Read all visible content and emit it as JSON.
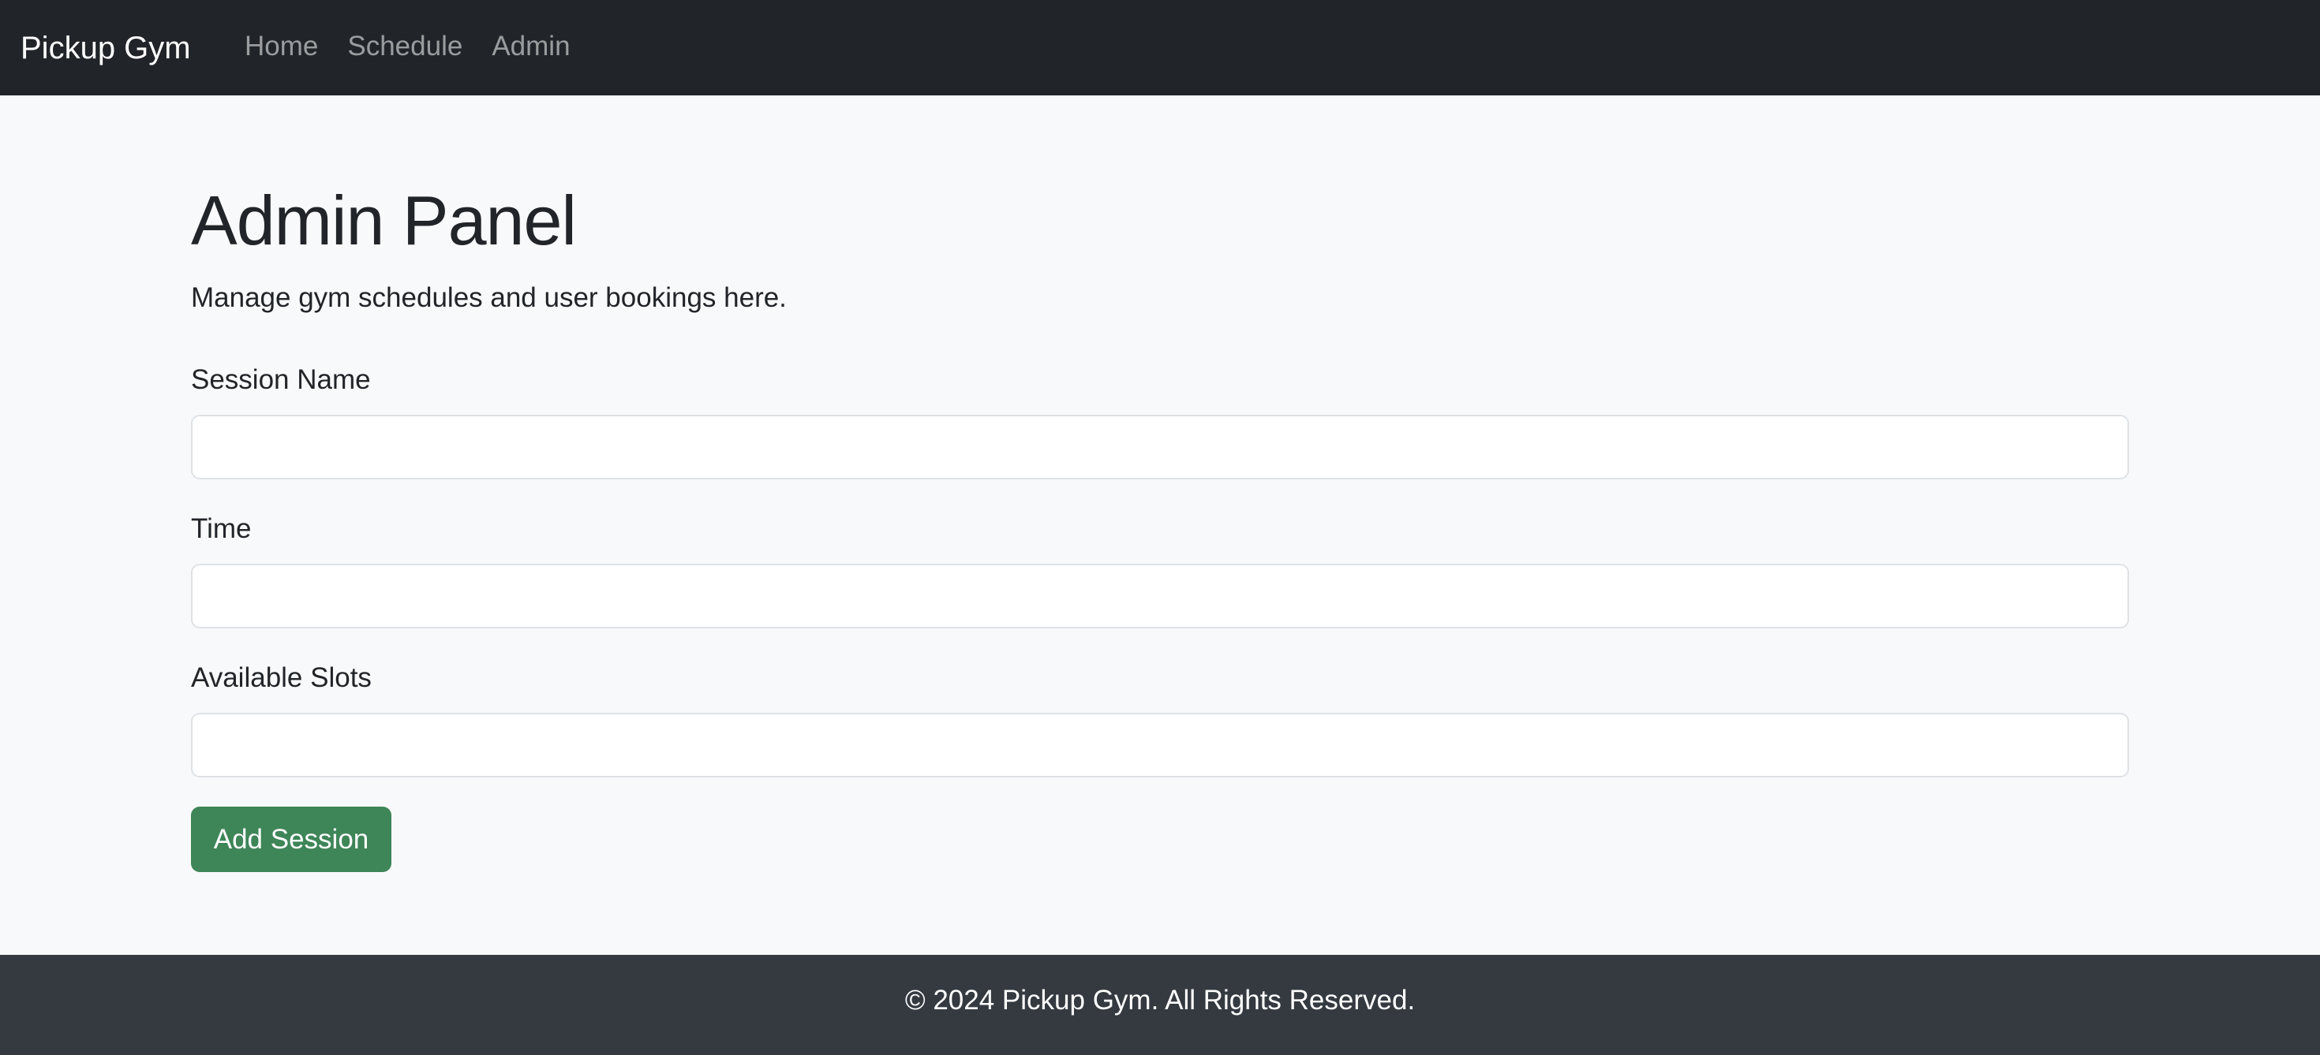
{
  "navbar": {
    "brand": "Pickup Gym",
    "links": [
      {
        "label": "Home"
      },
      {
        "label": "Schedule"
      },
      {
        "label": "Admin"
      }
    ]
  },
  "main": {
    "title": "Admin Panel",
    "subtitle": "Manage gym schedules and user bookings here.",
    "form": {
      "session_name_label": "Session Name",
      "session_name_value": "",
      "time_label": "Time",
      "time_value": "",
      "slots_label": "Available Slots",
      "slots_value": "",
      "submit_label": "Add Session"
    }
  },
  "footer": {
    "text": "© 2024 Pickup Gym. All Rights Reserved."
  },
  "colors": {
    "navbar_bg": "#212529",
    "page_bg": "#f8f9fa",
    "button_bg": "#3e8558",
    "footer_bg": "#343a40"
  }
}
